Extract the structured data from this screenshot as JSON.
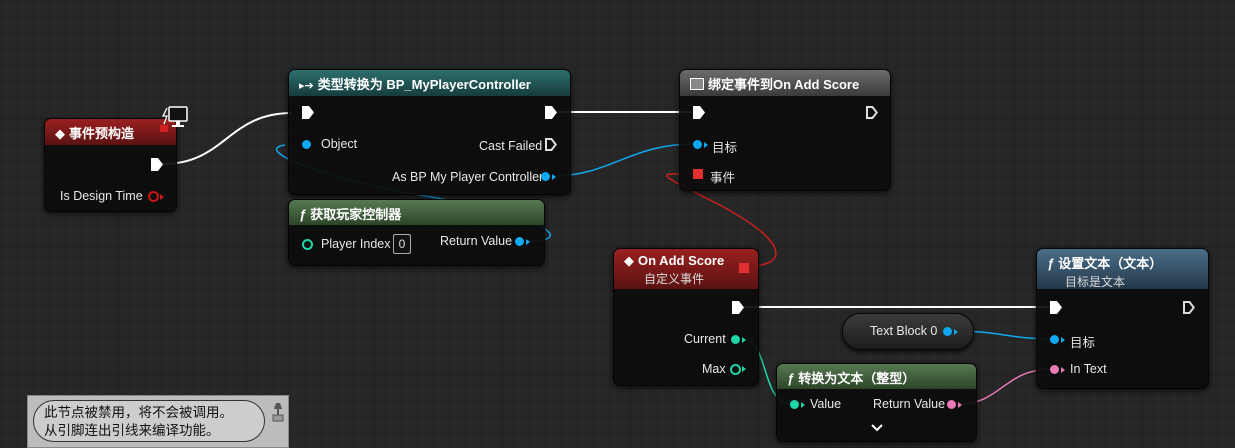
{
  "nodes": {
    "construct": {
      "title": "事件预构造",
      "pin_design_time": "Is Design Time"
    },
    "cast": {
      "title": "类型转换为 BP_MyPlayerController",
      "pin_object": "Object",
      "pin_cast_failed": "Cast Failed",
      "pin_as": "As BP My Player Controller"
    },
    "get_pc": {
      "title": "获取玩家控制器",
      "pin_player_index": "Player Index",
      "player_index_value": "0",
      "pin_return": "Return Value"
    },
    "bind": {
      "title": "绑定事件到On Add Score",
      "pin_target": "目标",
      "pin_event": "事件"
    },
    "custom_event": {
      "title": "On Add Score",
      "subtitle": "自定义事件",
      "pin_current": "Current",
      "pin_max": "Max"
    },
    "text_block": {
      "label": "Text Block 0"
    },
    "set_text": {
      "title": "设置文本（文本）",
      "subtitle": "目标是文本",
      "pin_target": "目标",
      "pin_in_text": "In Text"
    },
    "to_text": {
      "title": "转换为文本（整型）",
      "pin_value": "Value",
      "pin_return": "Return Value"
    }
  },
  "comment": {
    "line1": "此节点被禁用，将不会被调用。",
    "line2": "从引脚连出引线来编译功能。"
  },
  "colors": {
    "exec": "#ffffff",
    "object": "#10a8f0",
    "struct": "#0cbcd0",
    "int": "#1ed6a8",
    "text": "#e87ab8",
    "event": "#e23030"
  }
}
